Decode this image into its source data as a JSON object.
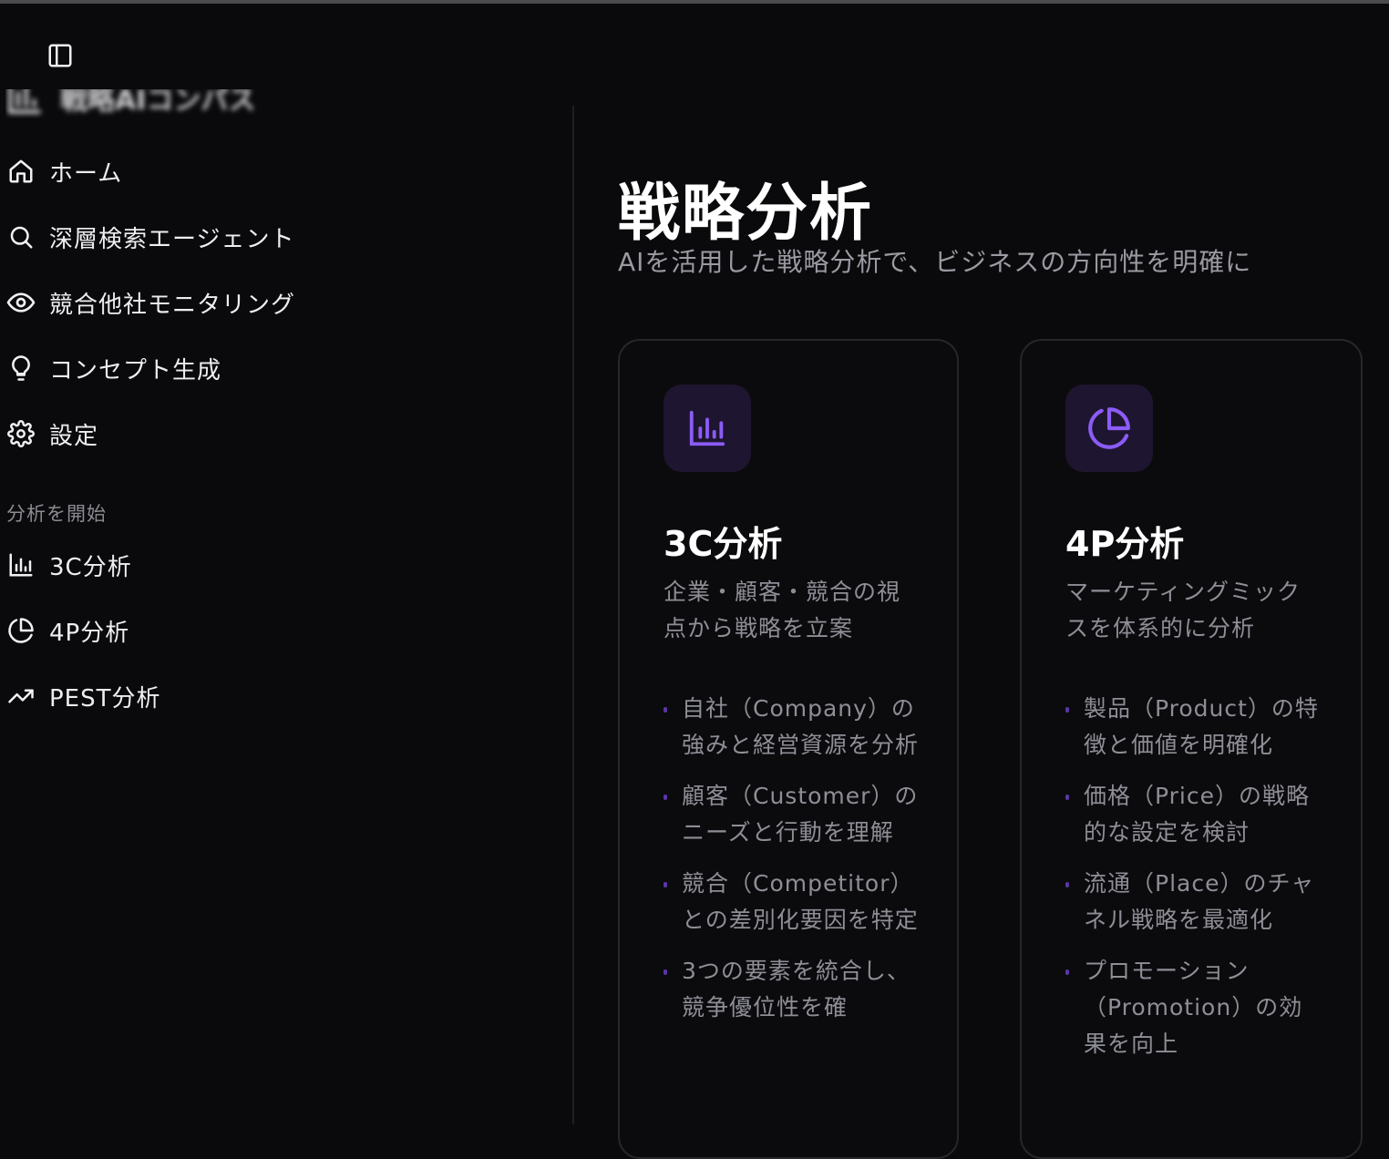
{
  "sidebar": {
    "app_name": "戦略AIコンパス",
    "nav": [
      {
        "label": "ホーム",
        "icon": "home-icon"
      },
      {
        "label": "深層検索エージェント",
        "icon": "search-icon"
      },
      {
        "label": "競合他社モニタリング",
        "icon": "eye-icon"
      },
      {
        "label": "コンセプト生成",
        "icon": "lightbulb-icon"
      },
      {
        "label": "設定",
        "icon": "gear-icon"
      }
    ],
    "section_label": "分析を開始",
    "analysis": [
      {
        "label": "3C分析",
        "icon": "bar-chart-icon"
      },
      {
        "label": "4P分析",
        "icon": "pie-chart-icon"
      },
      {
        "label": "PEST分析",
        "icon": "trending-up-icon"
      }
    ]
  },
  "main": {
    "title": "戦略分析",
    "subtitle": "AIを活用した戦略分析で、ビジネスの方向性を明確に",
    "cards": [
      {
        "title": "3C分析",
        "icon": "bar-chart-icon",
        "description": "企業・顧客・競合の視点から戦略を立案",
        "points": [
          "自社（Company）の強みと経営資源を分析",
          "顧客（Customer）のニーズと行動を理解",
          "競合（Competitor）との差別化要因を特定",
          "3つの要素を統合し、競争優位性を確"
        ]
      },
      {
        "title": "4P分析",
        "icon": "pie-chart-icon",
        "description": "マーケティングミックスを体系的に分析",
        "points": [
          "製品（Product）の特徴と価値を明確化",
          "価格（Price）の戦略的な設定を検討",
          "流通（Place）のチャネル戦略を最適化",
          "プロモーション（Promotion）の効果を向上"
        ]
      }
    ]
  },
  "colors": {
    "background": "#0a0a0c",
    "accent": "#8b5cf6",
    "icon_tile": "#1e1530",
    "muted_text": "#8e8e96"
  }
}
